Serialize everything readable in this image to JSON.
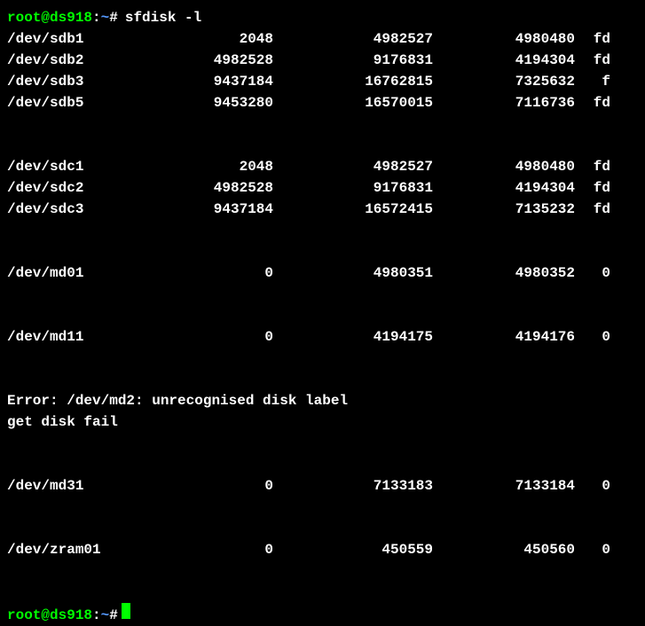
{
  "prompt": {
    "user_host": "root@ds918",
    "colon": ":",
    "path": "~",
    "hash": "#",
    "command": "sfdisk -l"
  },
  "partitions_sdb": [
    {
      "device": "/dev/sdb1",
      "start": "2048",
      "end": "4982527",
      "sectors": "4980480",
      "type": "fd"
    },
    {
      "device": "/dev/sdb2",
      "start": "4982528",
      "end": "9176831",
      "sectors": "4194304",
      "type": "fd"
    },
    {
      "device": "/dev/sdb3",
      "start": "9437184",
      "end": "16762815",
      "sectors": "7325632",
      "type": "f"
    },
    {
      "device": "/dev/sdb5",
      "start": "9453280",
      "end": "16570015",
      "sectors": "7116736",
      "type": "fd"
    }
  ],
  "partitions_sdc": [
    {
      "device": "/dev/sdc1",
      "start": "2048",
      "end": "4982527",
      "sectors": "4980480",
      "type": "fd"
    },
    {
      "device": "/dev/sdc2",
      "start": "4982528",
      "end": "9176831",
      "sectors": "4194304",
      "type": "fd"
    },
    {
      "device": "/dev/sdc3",
      "start": "9437184",
      "end": "16572415",
      "sectors": "7135232",
      "type": "fd"
    }
  ],
  "partitions_md0": [
    {
      "device": "/dev/md01",
      "start": "0",
      "end": "4980351",
      "sectors": "4980352",
      "type": "0"
    }
  ],
  "partitions_md1": [
    {
      "device": "/dev/md11",
      "start": "0",
      "end": "4194175",
      "sectors": "4194176",
      "type": "0"
    }
  ],
  "error": {
    "line1": "Error: /dev/md2: unrecognised disk label",
    "line2": "get disk fail"
  },
  "partitions_md3": [
    {
      "device": "/dev/md31",
      "start": "0",
      "end": "7133183",
      "sectors": "7133184",
      "type": "0"
    }
  ],
  "partitions_zram": [
    {
      "device": "/dev/zram01",
      "start": "0",
      "end": "450559",
      "sectors": "450560",
      "type": "0"
    }
  ]
}
